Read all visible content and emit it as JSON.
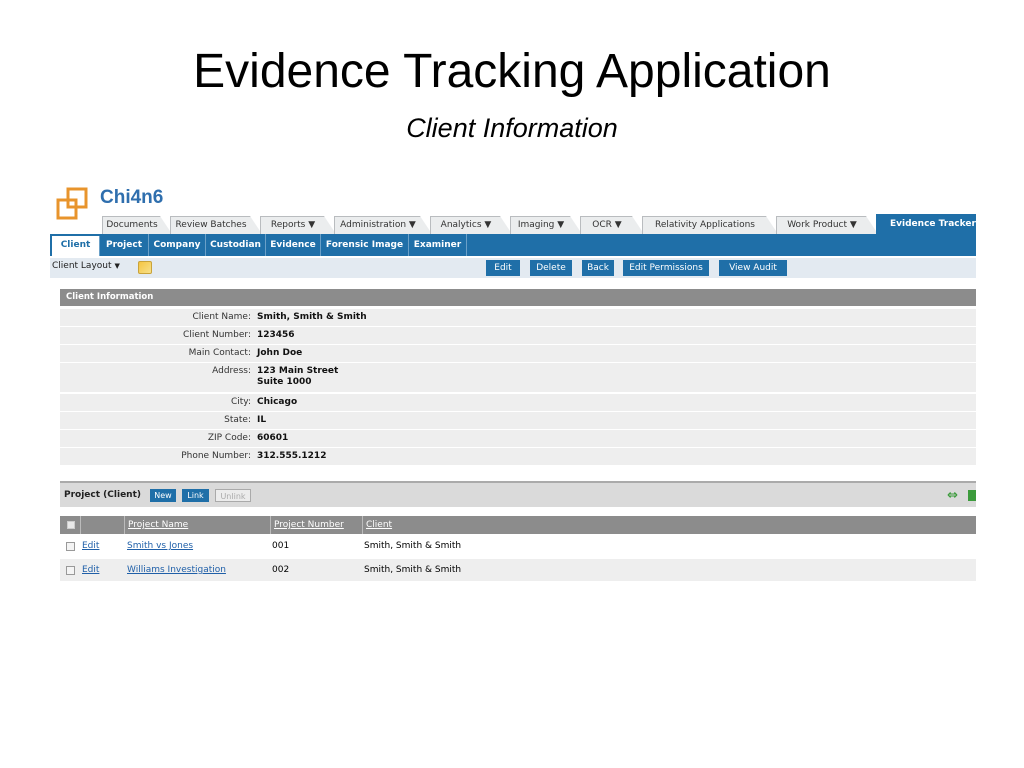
{
  "slide": {
    "title": "Evidence Tracking Application",
    "subtitle": "Client Information"
  },
  "app": {
    "brand": "Chi4n6",
    "accent_color": "#1f6fa8",
    "logo_color": "#e8942c",
    "tabs": [
      {
        "label": "Documents"
      },
      {
        "label": "Review Batches"
      },
      {
        "label": "Reports ▼"
      },
      {
        "label": "Administration ▼"
      },
      {
        "label": "Analytics ▼"
      },
      {
        "label": "Imaging ▼"
      },
      {
        "label": "OCR ▼"
      },
      {
        "label": "Relativity Applications"
      },
      {
        "label": "Work Product ▼"
      },
      {
        "label": "Evidence Tracker ▼",
        "active": true
      }
    ],
    "subnav": [
      {
        "label": "Client",
        "active": true
      },
      {
        "label": "Project"
      },
      {
        "label": "Company"
      },
      {
        "label": "Custodian"
      },
      {
        "label": "Evidence"
      },
      {
        "label": "Forensic Image"
      },
      {
        "label": "Examiner"
      }
    ],
    "toolbar": {
      "layout_value": "Client Layout",
      "buttons": [
        "Edit",
        "Delete",
        "Back",
        "Edit Permissions",
        "View Audit"
      ]
    },
    "client_info": {
      "header": "Client Information",
      "rows": [
        {
          "label": "Client Name:",
          "value": "Smith, Smith & Smith"
        },
        {
          "label": "Client Number:",
          "value": "123456"
        },
        {
          "label": "Main Contact:",
          "value": "John Doe"
        },
        {
          "label": "Address:",
          "value": "123 Main Street",
          "value2": "Suite 1000"
        },
        {
          "label": "City:",
          "value": "Chicago"
        },
        {
          "label": "State:",
          "value": "IL"
        },
        {
          "label": "ZIP Code:",
          "value": "60601"
        },
        {
          "label": "Phone Number:",
          "value": "312.555.1212"
        }
      ]
    },
    "projects": {
      "title": "Project (Client)",
      "buttons": {
        "new": "New",
        "link": "Link",
        "unlink": "Unlink"
      },
      "columns": [
        "Project Name",
        "Project Number",
        "Client"
      ],
      "edit_label": "Edit",
      "rows": [
        {
          "name": "Smith vs Jones",
          "number": "001",
          "client": "Smith, Smith & Smith"
        },
        {
          "name": "Williams Investigation",
          "number": "002",
          "client": "Smith, Smith & Smith"
        }
      ]
    }
  }
}
